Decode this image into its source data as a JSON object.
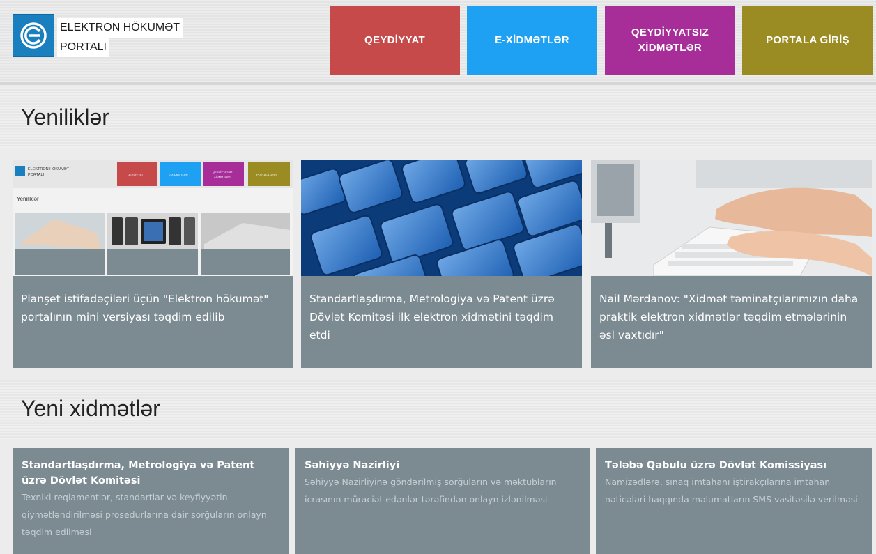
{
  "header": {
    "logo_line1": "ELEKTRON HÖKUMƏT",
    "logo_line2": "PORTALI",
    "nav": [
      {
        "label": "QEYDİYYAT",
        "color": "#c64a4a"
      },
      {
        "label": "E-XİDMƏTLƏR",
        "color": "#1ea1f2"
      },
      {
        "label": "QEYDİYYATSIZ XİDMƏTLƏR",
        "color": "#a72e99"
      },
      {
        "label": "PORTALA GİRİŞ",
        "color": "#9a8b22"
      }
    ]
  },
  "news": {
    "title": "Yeniliklər",
    "items": [
      {
        "text": "Planşet istifadəçiləri üçün \"Elektron hökumət\" portalının mini versiyası təqdim edilib",
        "image": "portal-screenshot"
      },
      {
        "text": "Standartlaşdırma, Metrologiya və Patent üzrə Dövlət Komitəsi ilk elektron xidmətini təqdim etdi",
        "image": "blue-keyboard"
      },
      {
        "text": "Nail Mərdanov: \"Xidmət təminatçılarımızın daha praktik elektron xidmətlər təqdim etmələrinin əsl vaxtıdır\"",
        "image": "hands-typing"
      }
    ],
    "mini_preview": {
      "logo_line1": "ELEKTRON HÖKUMƏT",
      "logo_line2": "PORTALI",
      "nav": [
        "QEYDİYYAT",
        "E-XİDMƏTLƏR",
        "QEYDİYYATSIZ",
        "XİDMƏTLƏR",
        "PORTALA GİRİŞ"
      ],
      "title": "Yeniliklər"
    }
  },
  "services": {
    "title": "Yeni xidmətlər",
    "items": [
      {
        "title": "Standartlaşdırma, Metrologiya və Patent üzrə Dövlət Komitəsi",
        "desc": "Texniki reqlamentlər, standartlar və keyfiyyətin qiymətləndirilməsi prosedurlarına dair sorğuların onlayn təqdim edilməsi"
      },
      {
        "title": "Səhiyyə Nazirliyi",
        "desc": "Səhiyyə Nazirliyinə göndərilmiş sorğuların və məktubların icrasının müraciət edənlər tərəfindən onlayn izlənilməsi"
      },
      {
        "title": "Tələbə Qəbulu üzrə Dövlət Komissiyası",
        "desc": "Namizədlərə, sınaq imtahanı iştirakçılarına imtahan nəticələri haqqında məlumatların SMS vasitəsilə verilməsi"
      }
    ]
  }
}
